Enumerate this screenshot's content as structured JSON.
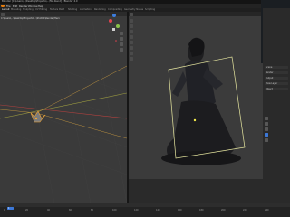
{
  "window": {
    "title": "Blender [C:\\Users\\...\\Desktop\\Projects\\...\\file.blend] - Blender 4.0"
  },
  "menu": [
    "File",
    "Edit",
    "Render",
    "Window",
    "Help"
  ],
  "workspace_tabs": [
    "Layout",
    "Modeling",
    "Sculpting",
    "UV Editing",
    "Texture Paint",
    "Shading",
    "Animation",
    "Rendering",
    "Compositing",
    "Geometry Nodes",
    "Scripting"
  ],
  "viewport": {
    "path_text": "C:\\Users\\...\\Desktop\\Projects\\...\\Shot01\\Render\\Hero",
    "gizmo_colors": {
      "x": "#e0434f",
      "y": "#8bc34a",
      "z": "#3c7ddf"
    }
  },
  "render_view": {
    "frame_color": "#e8e8a0",
    "accent": "#f2e94a"
  },
  "properties": {
    "labels": [
      "Scene",
      "Render",
      "Output",
      "View Layer",
      "Object"
    ]
  },
  "timeline": {
    "current_frame": "1",
    "ticks": [
      "0",
      "20",
      "40",
      "60",
      "80",
      "100",
      "120",
      "140",
      "160",
      "180",
      "200",
      "220",
      "240"
    ]
  },
  "colors": {
    "blender_orange": "#e87d0d",
    "selection": "#f2a533",
    "playhead": "#3c78d8"
  }
}
